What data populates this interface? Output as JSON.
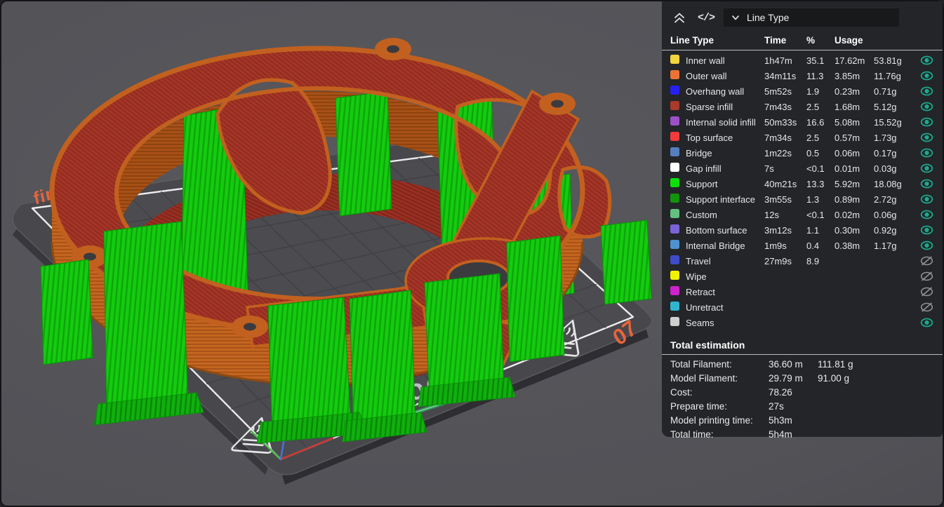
{
  "panel": {
    "header": {
      "collapse_icon": "chevrons-up",
      "gcode_icon_glyph": "</>",
      "view_select_value": "Line Type"
    },
    "columns": {
      "line_type": "Line Type",
      "time": "Time",
      "percent": "%",
      "usage": "Usage"
    },
    "rows": [
      {
        "label": "Inner wall",
        "color": "#F2D43B",
        "time": "1h47m",
        "pct": "35.1",
        "len": "17.62m",
        "weight": "53.81g",
        "visible": true
      },
      {
        "label": "Outer wall",
        "color": "#ED7335",
        "time": "34m11s",
        "pct": "11.3",
        "len": "3.85m",
        "weight": "11.76g",
        "visible": true
      },
      {
        "label": "Overhang wall",
        "color": "#2621F2",
        "time": "5m52s",
        "pct": "1.9",
        "len": "0.23m",
        "weight": "0.71g",
        "visible": true
      },
      {
        "label": "Sparse infill",
        "color": "#AA3A2A",
        "time": "7m43s",
        "pct": "2.5",
        "len": "1.68m",
        "weight": "5.12g",
        "visible": true
      },
      {
        "label": "Internal solid infill",
        "color": "#9D50C8",
        "time": "50m33s",
        "pct": "16.6",
        "len": "5.08m",
        "weight": "15.52g",
        "visible": true
      },
      {
        "label": "Top surface",
        "color": "#F23B3B",
        "time": "7m34s",
        "pct": "2.5",
        "len": "0.57m",
        "weight": "1.73g",
        "visible": true
      },
      {
        "label": "Bridge",
        "color": "#557EC0",
        "time": "1m22s",
        "pct": "0.5",
        "len": "0.06m",
        "weight": "0.17g",
        "visible": true
      },
      {
        "label": "Gap infill",
        "color": "#FFFFFF",
        "time": "7s",
        "pct": "<0.1",
        "len": "0.01m",
        "weight": "0.03g",
        "visible": true
      },
      {
        "label": "Support",
        "color": "#0AE00A",
        "time": "40m21s",
        "pct": "13.3",
        "len": "5.92m",
        "weight": "18.08g",
        "visible": true
      },
      {
        "label": "Support interface",
        "color": "#12950D",
        "time": "3m55s",
        "pct": "1.3",
        "len": "0.89m",
        "weight": "2.72g",
        "visible": true
      },
      {
        "label": "Custom",
        "color": "#62C17E",
        "time": "12s",
        "pct": "<0.1",
        "len": "0.02m",
        "weight": "0.06g",
        "visible": true
      },
      {
        "label": "Bottom surface",
        "color": "#7A63D6",
        "time": "3m12s",
        "pct": "1.1",
        "len": "0.30m",
        "weight": "0.92g",
        "visible": true
      },
      {
        "label": "Internal Bridge",
        "color": "#4E92CE",
        "time": "1m9s",
        "pct": "0.4",
        "len": "0.38m",
        "weight": "1.17g",
        "visible": true
      },
      {
        "label": "Travel",
        "color": "#3E4CC8",
        "time": "27m9s",
        "pct": "8.9",
        "len": "",
        "weight": "",
        "visible": false
      },
      {
        "label": "Wipe",
        "color": "#F2F200",
        "time": "",
        "pct": "",
        "len": "",
        "weight": "",
        "visible": false
      },
      {
        "label": "Retract",
        "color": "#CE22CE",
        "time": "",
        "pct": "",
        "len": "",
        "weight": "",
        "visible": false
      },
      {
        "label": "Unretract",
        "color": "#2FB6CE",
        "time": "",
        "pct": "",
        "len": "",
        "weight": "",
        "visible": false
      },
      {
        "label": "Seams",
        "color": "#CFCFCF",
        "time": "",
        "pct": "",
        "len": "",
        "weight": "",
        "visible": true
      }
    ],
    "totals": {
      "title": "Total estimation",
      "items": [
        {
          "label": "Total Filament:",
          "value1": "36.60 m",
          "value2": "111.81 g"
        },
        {
          "label": "Model Filament:",
          "value1": "29.79 m",
          "value2": "91.00 g"
        },
        {
          "label": "Cost:",
          "value1": "78.26",
          "value2": ""
        },
        {
          "label": "Prepare time:",
          "value1": "27s",
          "value2": ""
        },
        {
          "label": "Model printing time:",
          "value1": "5h3m",
          "value2": ""
        },
        {
          "label": "Total time:",
          "value1": "5h4m",
          "value2": ""
        }
      ]
    },
    "eye_on_color": "#1AA98C",
    "eye_off_color": "#8F9296"
  },
  "viewport": {
    "plate_label": "final",
    "plate_number": "07",
    "plate_logo": "goroc",
    "colors": {
      "background": "#55555A",
      "plate": "#48484C",
      "plate_grid": "#3E3E43",
      "print_boundary": "#EDEDEE",
      "plate_text": "#E8643B",
      "model_wall": "#C2611F",
      "model_top_infill": "#A63527",
      "support": "#13CC0E",
      "wipe_line": "#2F9E57"
    }
  }
}
